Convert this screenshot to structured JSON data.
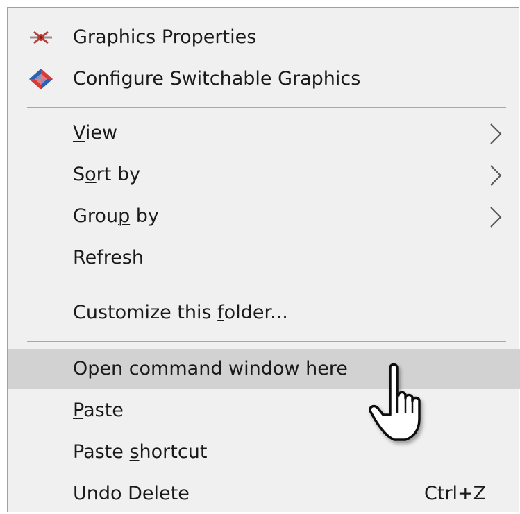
{
  "menu": {
    "items": [
      {
        "id": "graphics-properties",
        "parts": [
          "Graphics Properties"
        ],
        "icon": "graphics-properties-icon"
      },
      {
        "id": "configure-switchable-graphics",
        "parts": [
          "Configure Switchable Graphics"
        ],
        "icon": "switchable-graphics-icon"
      },
      {
        "id": "view",
        "parts": [
          "",
          "V",
          "iew"
        ],
        "submenu": true
      },
      {
        "id": "sort-by",
        "parts": [
          "S",
          "o",
          "rt by"
        ],
        "submenu": true
      },
      {
        "id": "group-by",
        "parts": [
          "Grou",
          "p",
          " by"
        ],
        "submenu": true
      },
      {
        "id": "refresh",
        "parts": [
          "R",
          "e",
          "fresh"
        ]
      },
      {
        "id": "customize-folder",
        "parts": [
          "Customize this ",
          "f",
          "older..."
        ]
      },
      {
        "id": "open-command-window",
        "parts": [
          "Open command ",
          "w",
          "indow here"
        ],
        "highlighted": true
      },
      {
        "id": "paste",
        "parts": [
          "",
          "P",
          "aste"
        ]
      },
      {
        "id": "paste-shortcut",
        "parts": [
          "Paste ",
          "s",
          "hortcut"
        ]
      },
      {
        "id": "undo-delete",
        "parts": [
          "",
          "U",
          "ndo Delete"
        ],
        "shortcut": "Ctrl+Z"
      }
    ],
    "colors": {
      "background": "#f0f0f0",
      "highlight": "#d2d2d2",
      "separator": "#a8a8a8",
      "text": "#1a1a1a"
    }
  }
}
